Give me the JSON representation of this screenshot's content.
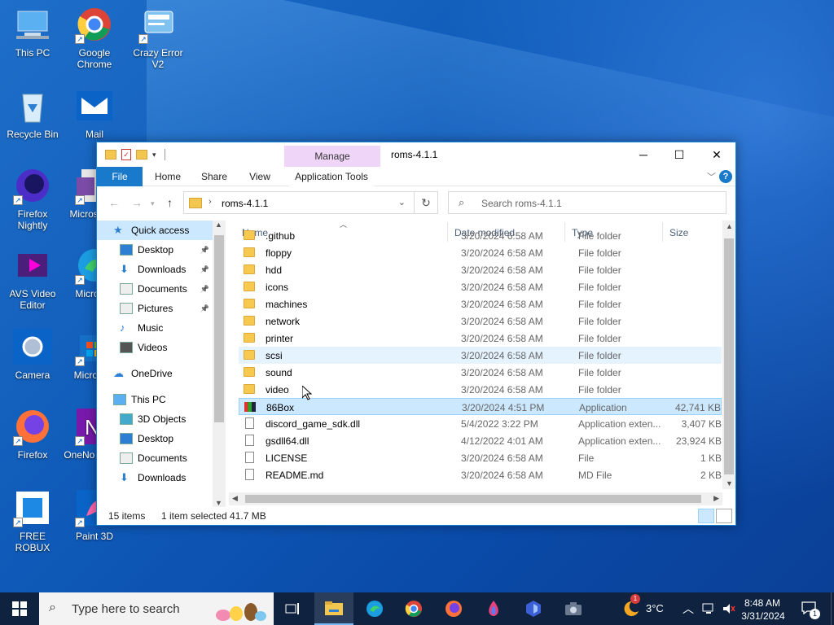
{
  "desktop": {
    "icons": [
      {
        "label": "This PC",
        "icon": "this-pc-icon"
      },
      {
        "label": "Google Chrome",
        "icon": "chrome-icon"
      },
      {
        "label": "Crazy Error V2",
        "icon": "shortcut-icon"
      },
      {
        "label": "Recycle Bin",
        "icon": "recycle-bin-icon"
      },
      {
        "label": "Mail",
        "icon": "mail-icon"
      },
      {
        "label": "Firefox Nightly",
        "icon": "firefox-nightly-icon"
      },
      {
        "label": "Micros (Offi",
        "icon": "office-icon"
      },
      {
        "label": "AVS Video Editor",
        "icon": "video-editor-icon"
      },
      {
        "label": "Micro Ed",
        "icon": "edge-icon"
      },
      {
        "label": "Camera",
        "icon": "camera-icon"
      },
      {
        "label": "Micro Sto",
        "icon": "store-icon"
      },
      {
        "label": "Firefox",
        "icon": "firefox-icon"
      },
      {
        "label": "OneNo Windo",
        "icon": "onenote-icon"
      },
      {
        "label": "FREE ROBUX",
        "icon": "free-robux-icon"
      },
      {
        "label": "Paint 3D",
        "icon": "paint3d-icon"
      }
    ]
  },
  "explorer": {
    "title": "roms-4.1.1",
    "manage_tab": "Manage",
    "ribbon_tabs": [
      "File",
      "Home",
      "Share",
      "View",
      "Application Tools"
    ],
    "address": {
      "crumb": "roms-4.1.1"
    },
    "search_placeholder": "Search roms-4.1.1",
    "nav_pane": {
      "items": [
        {
          "label": "Quick access",
          "icon": "star-icon",
          "pinned": false,
          "selected": true
        },
        {
          "label": "Desktop",
          "icon": "desktop-icon",
          "pinned": true
        },
        {
          "label": "Downloads",
          "icon": "download-icon",
          "pinned": true
        },
        {
          "label": "Documents",
          "icon": "documents-icon",
          "pinned": true
        },
        {
          "label": "Pictures",
          "icon": "pictures-icon",
          "pinned": true
        },
        {
          "label": "Music",
          "icon": "music-icon",
          "pinned": false
        },
        {
          "label": "Videos",
          "icon": "videos-icon",
          "pinned": false
        },
        {
          "label": "OneDrive",
          "icon": "cloud-icon",
          "pinned": false
        },
        {
          "label": "This PC",
          "icon": "this-pc-icon",
          "pinned": false
        },
        {
          "label": "3D Objects",
          "icon": "cube-icon",
          "pinned": false
        },
        {
          "label": "Desktop",
          "icon": "desktop-icon",
          "pinned": false
        },
        {
          "label": "Documents",
          "icon": "documents-icon",
          "pinned": false
        },
        {
          "label": "Downloads",
          "icon": "download-icon",
          "pinned": false
        }
      ]
    },
    "columns": [
      "Name",
      "Date modified",
      "Type",
      "Size"
    ],
    "files": [
      {
        "name": ".github",
        "date": "3/20/2024 6:58 AM",
        "type": "File folder",
        "size": "",
        "kind": "folder"
      },
      {
        "name": "floppy",
        "date": "3/20/2024 6:58 AM",
        "type": "File folder",
        "size": "",
        "kind": "folder"
      },
      {
        "name": "hdd",
        "date": "3/20/2024 6:58 AM",
        "type": "File folder",
        "size": "",
        "kind": "folder"
      },
      {
        "name": "icons",
        "date": "3/20/2024 6:58 AM",
        "type": "File folder",
        "size": "",
        "kind": "folder"
      },
      {
        "name": "machines",
        "date": "3/20/2024 6:58 AM",
        "type": "File folder",
        "size": "",
        "kind": "folder"
      },
      {
        "name": "network",
        "date": "3/20/2024 6:58 AM",
        "type": "File folder",
        "size": "",
        "kind": "folder"
      },
      {
        "name": "printer",
        "date": "3/20/2024 6:58 AM",
        "type": "File folder",
        "size": "",
        "kind": "folder"
      },
      {
        "name": "scsi",
        "date": "3/20/2024 6:58 AM",
        "type": "File folder",
        "size": "",
        "kind": "folder",
        "hover": true
      },
      {
        "name": "sound",
        "date": "3/20/2024 6:58 AM",
        "type": "File folder",
        "size": "",
        "kind": "folder"
      },
      {
        "name": "video",
        "date": "3/20/2024 6:58 AM",
        "type": "File folder",
        "size": "",
        "kind": "folder"
      },
      {
        "name": "86Box",
        "date": "3/20/2024 4:51 PM",
        "type": "Application",
        "size": "42,741 KB",
        "kind": "app",
        "selected": true
      },
      {
        "name": "discord_game_sdk.dll",
        "date": "5/4/2022 3:22 PM",
        "type": "Application exten...",
        "size": "3,407 KB",
        "kind": "doc"
      },
      {
        "name": "gsdll64.dll",
        "date": "4/12/2022 4:01 AM",
        "type": "Application exten...",
        "size": "23,924 KB",
        "kind": "doc"
      },
      {
        "name": "LICENSE",
        "date": "3/20/2024 6:58 AM",
        "type": "File",
        "size": "1 KB",
        "kind": "doc"
      },
      {
        "name": "README.md",
        "date": "3/20/2024 6:58 AM",
        "type": "MD File",
        "size": "2 KB",
        "kind": "doc"
      }
    ],
    "status": {
      "count": "15 items",
      "selection": "1 item selected  41.7 MB"
    }
  },
  "taskbar": {
    "search_placeholder": "Type here to search",
    "weather": "3°C",
    "time": "8:48 AM",
    "date": "3/31/2024",
    "notification_count": "1",
    "weather_badge": "1"
  },
  "colors": {
    "accent": "#1979ca",
    "selection": "#cce8ff",
    "taskbar": "#0f2340"
  }
}
